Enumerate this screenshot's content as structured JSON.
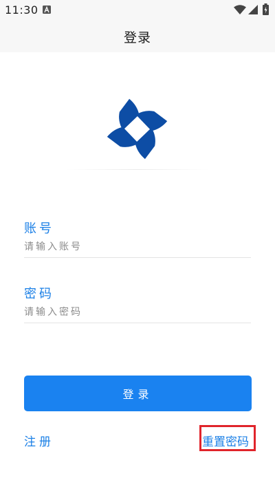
{
  "status_bar": {
    "time": "11:30",
    "icons": [
      "a-icon",
      "wifi-icon",
      "signal-icon",
      "battery-icon"
    ]
  },
  "header": {
    "title": "登录"
  },
  "logo": {
    "icon": "brand-logo-icon",
    "color": "#0d4da5"
  },
  "form": {
    "account": {
      "label": "账号",
      "placeholder": "请输入账号",
      "value": ""
    },
    "password": {
      "label": "密码",
      "placeholder": "请输入密码",
      "value": ""
    },
    "login_label": "登录"
  },
  "footer": {
    "register_label": "注册",
    "reset_label": "重置密码"
  },
  "colors": {
    "accent": "#1a82f0",
    "label": "#1a7fe6",
    "highlight": "#e0242b"
  }
}
